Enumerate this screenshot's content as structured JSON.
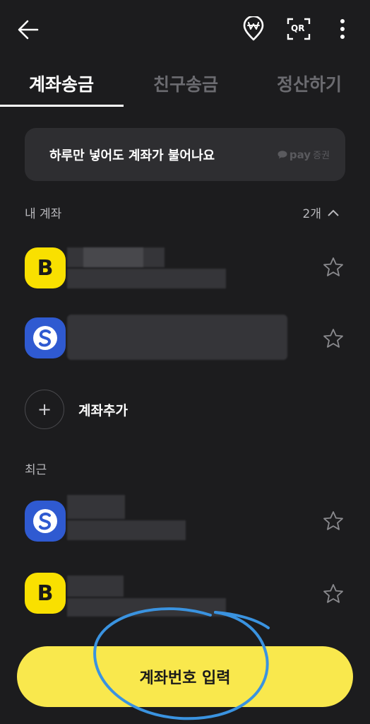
{
  "header": {
    "icons": [
      "back-arrow-icon",
      "won-location-icon",
      "qr-scan-icon",
      "more-vertical-icon"
    ],
    "qr_label": "QR"
  },
  "tabs": [
    {
      "label": "계좌송금",
      "active": true
    },
    {
      "label": "친구송금",
      "active": false
    },
    {
      "label": "정산하기",
      "active": false
    }
  ],
  "promo": {
    "text": "하루만 넣어도 계좌가 불어나요",
    "badge_brand": "pay",
    "badge_suffix": "증권"
  },
  "my_accounts": {
    "label": "내 계좌",
    "count": "2개",
    "items": [
      {
        "bank": "kakao",
        "logo_letter": "B"
      },
      {
        "bank": "shinhan",
        "logo_letter": "S"
      }
    ]
  },
  "add_account": {
    "plus": "+",
    "label": "계좌추가"
  },
  "recent": {
    "label": "최근",
    "items": [
      {
        "bank": "shinhan",
        "logo_letter": "S"
      },
      {
        "bank": "kakao",
        "logo_letter": "B"
      }
    ]
  },
  "cta": {
    "label": "계좌번호 입력"
  },
  "colors": {
    "background": "#1c1c1e",
    "accent_yellow": "#f9e84d",
    "kakao_yellow": "#f9e000",
    "shinhan_blue": "#2f5ad1",
    "annotation_blue": "#3a93e0"
  }
}
